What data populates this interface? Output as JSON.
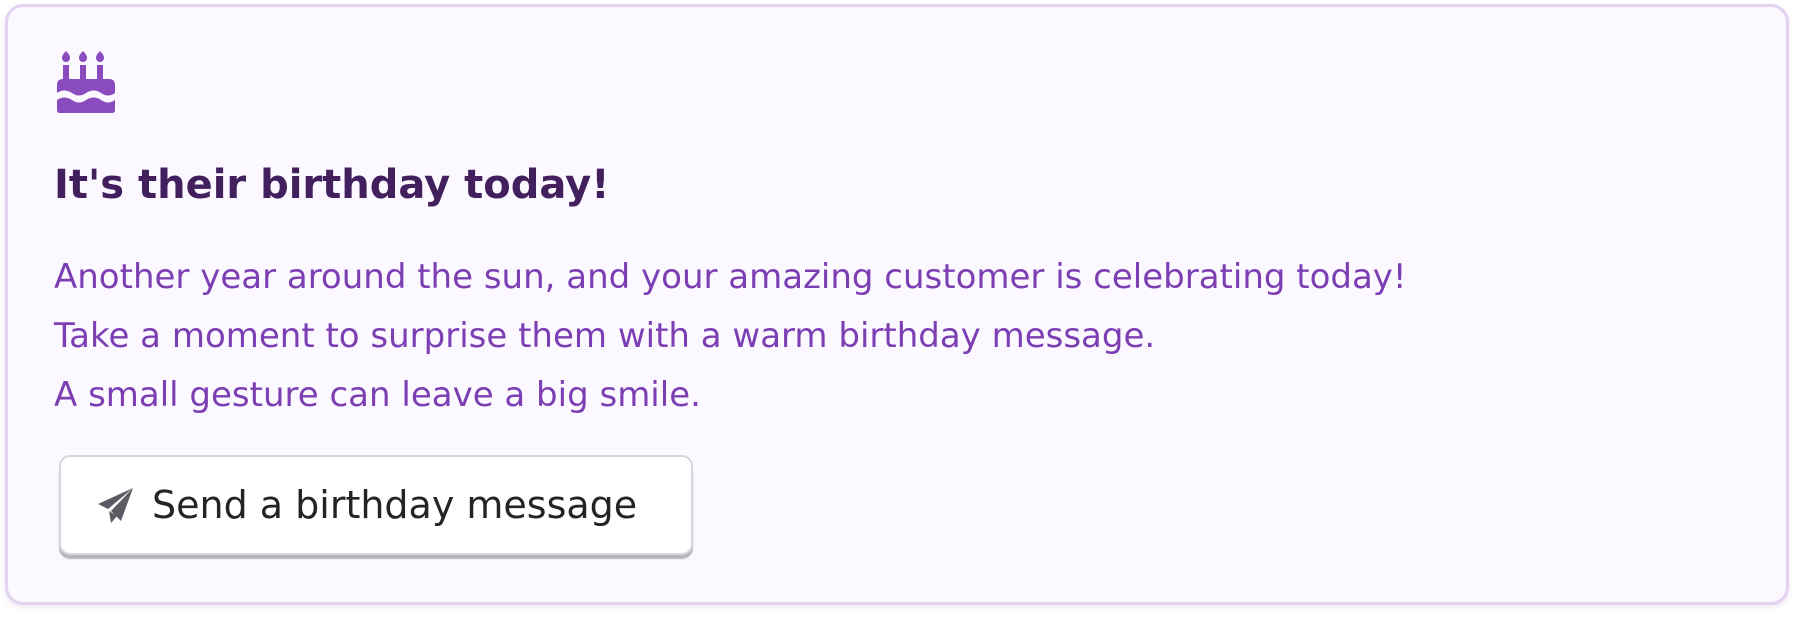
{
  "card": {
    "title": "It's their birthday today!",
    "body_lines": [
      "Another year around the sun, and your amazing customer is celebrating today!",
      "Take a moment to surprise them with a warm birthday message.",
      "A small gesture can leave a big smile."
    ],
    "icon": "birthday-cake-icon",
    "button": {
      "label": "Send a birthday message",
      "icon": "paper-plane-icon"
    }
  },
  "colors": {
    "card_background": "#fcf8ff",
    "card_border": "#e4d2f1",
    "accent": "#8a4bbf",
    "title": "#41205d",
    "body_text": "#7c3fb3",
    "button_text": "#242424",
    "button_icon": "#5c5b64"
  }
}
